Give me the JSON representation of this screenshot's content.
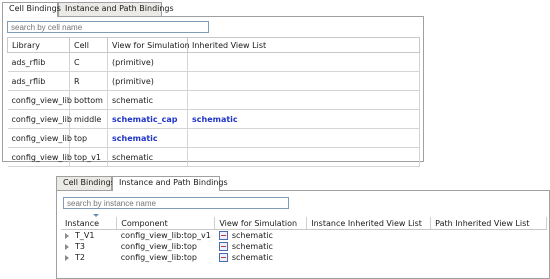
{
  "top_panel": {
    "tabs": [
      {
        "label": "Cell Bindings",
        "active": true
      },
      {
        "label": "Instance and Path Bindings",
        "active": false
      }
    ],
    "search": {
      "placeholder": "search by cell name",
      "value": ""
    },
    "columns": [
      "Library",
      "Cell",
      "View for Simulation",
      "Inherited View List"
    ],
    "rows": [
      {
        "library": "ads_rflib",
        "cell": "C",
        "view": "(primitive)",
        "inherited": ""
      },
      {
        "library": "ads_rflib",
        "cell": "R",
        "view": "(primitive)",
        "inherited": ""
      },
      {
        "library": "config_view_lib",
        "cell": "bottom",
        "view": "schematic",
        "inherited": ""
      },
      {
        "library": "config_view_lib",
        "cell": "middle",
        "view": "schematic_cap",
        "inherited": "schematic",
        "highlight": true
      },
      {
        "library": "config_view_lib",
        "cell": "top",
        "view": "schematic",
        "inherited": "",
        "view_highlight": true
      },
      {
        "library": "config_view_lib",
        "cell": "top_v1",
        "view": "schematic",
        "inherited": ""
      }
    ]
  },
  "bottom_panel": {
    "tabs": [
      {
        "label": "Cell Bindings",
        "active": false
      },
      {
        "label": "Instance and Path Bindings",
        "active": true
      }
    ],
    "search": {
      "placeholder": "search by instance name",
      "value": ""
    },
    "columns": [
      "Instance",
      "Component",
      "View for Simulation",
      "Instance Inherited View List",
      "Path Inherited View List"
    ],
    "rows": [
      {
        "instance": "T_V1",
        "component": "config_view_lib:top_v1",
        "view": "schematic"
      },
      {
        "instance": "T3",
        "component": "config_view_lib:top",
        "view": "schematic"
      },
      {
        "instance": "T2",
        "component": "config_view_lib:top",
        "view": "schematic"
      }
    ]
  },
  "colors": {
    "link_blue": "#1f35c9",
    "border": "#a0a0a0"
  }
}
